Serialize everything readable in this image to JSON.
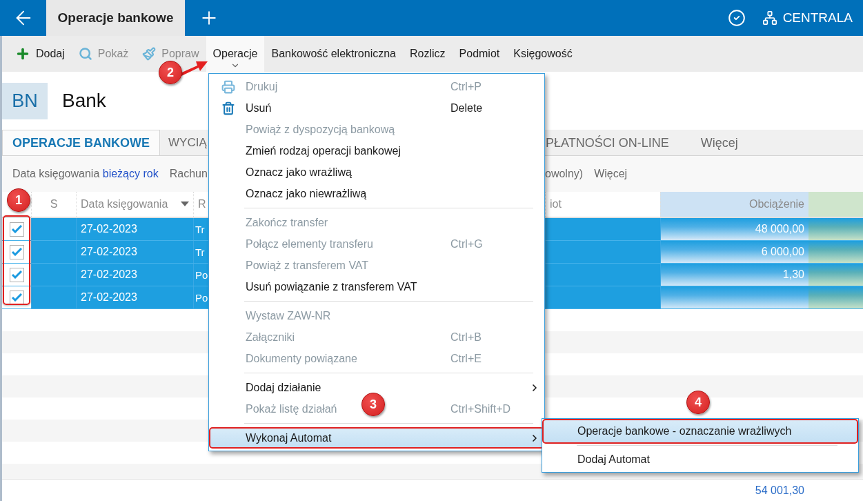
{
  "top_bar": {
    "tab": "Operacje bankowe",
    "branch": "CENTRALA"
  },
  "toolbar": [
    {
      "label": "Dodaj",
      "kind": "add",
      "disabled": false,
      "selected": false
    },
    {
      "label": "Pokaż",
      "kind": "view",
      "disabled": true,
      "selected": false
    },
    {
      "label": "Popraw",
      "kind": "edit",
      "disabled": true,
      "selected": false
    },
    {
      "label": "Operacje",
      "kind": "plain",
      "disabled": false,
      "selected": true
    },
    {
      "label": "Bankowość elektroniczna",
      "kind": "plain",
      "disabled": false,
      "selected": false
    },
    {
      "label": "Rozlicz",
      "kind": "plain",
      "disabled": false,
      "selected": false
    },
    {
      "label": "Podmiot",
      "kind": "plain",
      "disabled": false,
      "selected": false
    },
    {
      "label": "Księgowość",
      "kind": "plain",
      "disabled": false,
      "selected": false
    }
  ],
  "header": {
    "badge": "BN",
    "title": "Bank"
  },
  "tabs": {
    "left": [
      {
        "label": "OPERACJE BANKOWE",
        "selected": true
      },
      {
        "label": "WYCIĄ",
        "selected": false
      }
    ],
    "right": [
      {
        "label": "PŁATNOŚCI ON-LINE",
        "selected": false
      },
      {
        "label": "Więcej",
        "selected": false
      }
    ]
  },
  "filters": {
    "left": [
      {
        "label": "Data księgowania",
        "value": "bieżący rok"
      },
      {
        "label": "Rachun"
      }
    ],
    "right": [
      {
        "label": "owolny)"
      },
      {
        "label": "Więcej"
      }
    ]
  },
  "grid": {
    "annotated": true,
    "columns": [
      {
        "label": "S"
      },
      {
        "label": "Data księgowania",
        "sorted": true
      },
      {
        "label": "R"
      },
      {
        "label": "iot"
      },
      {
        "label": "Obciążenie"
      }
    ],
    "rows": [
      {
        "checked": true,
        "selected": true,
        "date": "27-02-2023",
        "column_4": "Tr",
        "debit": "48 000,00"
      },
      {
        "checked": true,
        "selected": true,
        "date": "27-02-2023",
        "column_4": "Tr",
        "debit": "6 000,00"
      },
      {
        "checked": true,
        "selected": true,
        "date": "27-02-2023",
        "column_4": "Po",
        "debit": "1,30"
      },
      {
        "checked": true,
        "selected": true,
        "date": "27-02-2023",
        "column_4": "Po"
      }
    ],
    "total": "54 001,30"
  },
  "menu": {
    "items": [
      {
        "kind": "print",
        "label": "Drukuj",
        "shortcut": "Ctrl+P",
        "disabled": true
      },
      {
        "kind": "delete",
        "label": "Usuń",
        "shortcut": "Delete",
        "disabled": false
      },
      {
        "kind": "plain",
        "label": "Powiąż z dyspozycją bankową",
        "disabled": true
      },
      {
        "kind": "plain",
        "label": "Zmień rodzaj operacji bankowej",
        "disabled": false
      },
      {
        "kind": "plain",
        "label": "Oznacz jako wrażliwą",
        "disabled": false
      },
      {
        "kind": "plain",
        "label": "Oznacz jako niewrażliwą",
        "disabled": false
      },
      {
        "kind": "separator"
      },
      {
        "kind": "plain",
        "label": "Zakończ transfer",
        "disabled": true
      },
      {
        "kind": "plain",
        "label": "Połącz elementy transferu",
        "shortcut": "Ctrl+G",
        "disabled": true
      },
      {
        "kind": "plain",
        "label": "Powiąż z transferem VAT",
        "disabled": true
      },
      {
        "kind": "plain",
        "label": "Usuń powiązanie z transferem VAT",
        "disabled": false
      },
      {
        "kind": "separator"
      },
      {
        "kind": "plain",
        "label": "Wystaw ZAW-NR",
        "disabled": true
      },
      {
        "kind": "plain",
        "label": "Załączniki",
        "shortcut": "Ctrl+B",
        "disabled": true
      },
      {
        "kind": "plain",
        "label": "Dokumenty powiązane",
        "shortcut": "Ctrl+E",
        "disabled": true
      },
      {
        "kind": "separator"
      },
      {
        "kind": "submenu",
        "label": "Dodaj działanie",
        "disabled": false,
        "selected": false,
        "annotated": false
      },
      {
        "kind": "plain",
        "label": "Pokaż listę działań",
        "shortcut": "Ctrl+Shift+D",
        "disabled": true
      },
      {
        "kind": "separator"
      },
      {
        "kind": "submenu",
        "label": "Wykonaj Automat",
        "disabled": false,
        "selected": true,
        "annotated": true
      }
    ]
  },
  "submenu": {
    "items": [
      {
        "kind": "plain",
        "label": "Operacje bankowe - oznaczanie wrażliwych",
        "selected": true,
        "annotated": true
      },
      {
        "kind": "separator"
      },
      {
        "kind": "plain",
        "label": "Dodaj Automat",
        "selected": false,
        "annotated": false
      }
    ]
  },
  "annotations": [
    {
      "label": "1"
    },
    {
      "label": "2"
    },
    {
      "label": "3"
    },
    {
      "label": "4"
    }
  ]
}
